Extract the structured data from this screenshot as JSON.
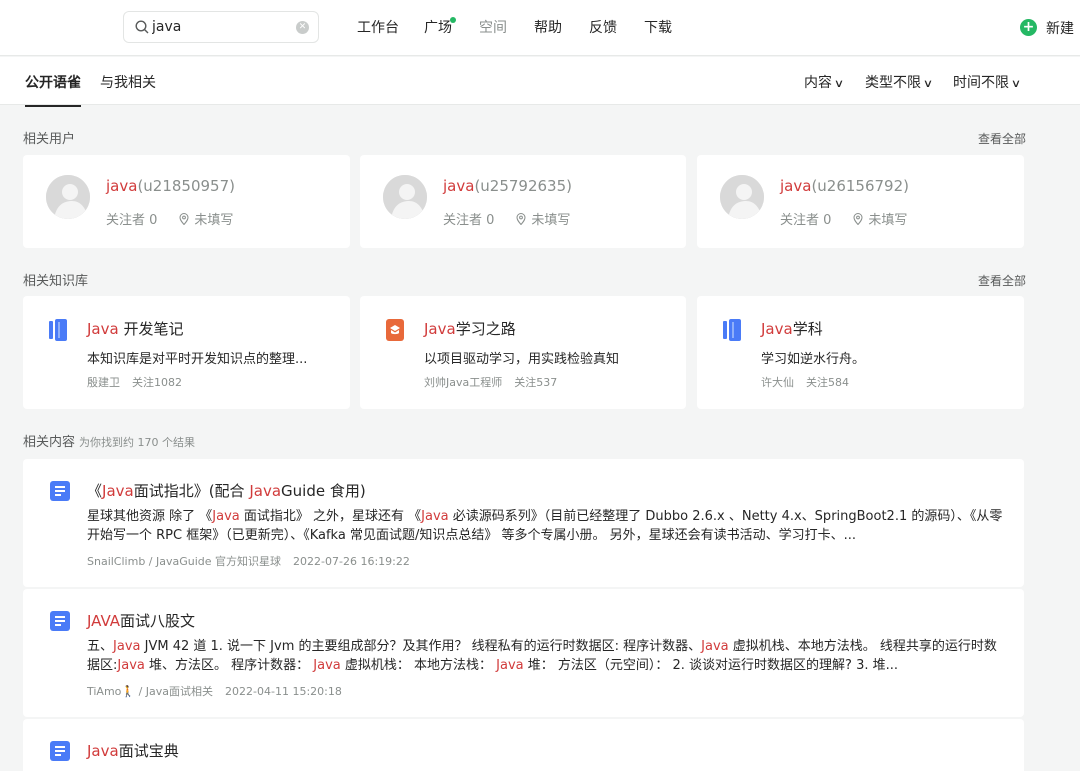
{
  "search": {
    "value": "java",
    "clear_icon": "close-circle-icon"
  },
  "nav": {
    "items": [
      "工作台",
      "广场",
      "空间",
      "帮助",
      "反馈",
      "下载"
    ],
    "new_label": "新建"
  },
  "tabs": [
    "公开语雀",
    "与我相关"
  ],
  "filters": [
    "内容",
    "类型不限",
    "时间不限"
  ],
  "users_section": {
    "title": "相关用户",
    "see_all": "查看全部",
    "users": [
      {
        "name_hl": "java",
        "name_rest": "(u21850957)",
        "followers": "关注者 0",
        "location": "未填写"
      },
      {
        "name_hl": "java",
        "name_rest": "(u25792635)",
        "followers": "关注者 0",
        "location": "未填写"
      },
      {
        "name_hl": "java",
        "name_rest": "(u26156792)",
        "followers": "关注者 0",
        "location": "未填写"
      }
    ]
  },
  "kb_section": {
    "title": "相关知识库",
    "see_all": "查看全部",
    "books": [
      {
        "name_hl": "Java",
        "name_rest": " 开发笔记",
        "desc": "本知识库是对平时开发知识点的整理...",
        "owner": "殷建卫",
        "follows": "关注1082",
        "icon": "book-blue-icon",
        "color": "#4a7bf7"
      },
      {
        "name_hl": "Java",
        "name_rest": "学习之路",
        "desc": "以项目驱动学习，用实践检验真知",
        "owner": "刘帅Java工程师",
        "follows": "关注537",
        "icon": "book-orange-icon",
        "color": "#e8693a"
      },
      {
        "name_hl": "Java",
        "name_rest": "学科",
        "desc": "学习如逆水行舟。",
        "owner": "许大仙",
        "follows": "关注584",
        "icon": "book-blue-icon",
        "color": "#4a7bf7"
      }
    ]
  },
  "docs_section": {
    "title": "相关内容",
    "count_text": "为你找到约 170 个结果",
    "docs": [
      {
        "title": [
          [
            "《",
            false
          ],
          [
            "Java",
            true
          ],
          [
            "面试指北》(配合 ",
            false
          ],
          [
            "Java",
            true
          ],
          [
            "Guide 食用)",
            false
          ]
        ],
        "desc": [
          [
            "星球其他资源 除了 《",
            false
          ],
          [
            "Java",
            true
          ],
          [
            " 面试指北》 之外，星球还有 《",
            false
          ],
          [
            "Java",
            true
          ],
          [
            " 必读源码系列》（目前已经整理了 Dubbo 2.6.x 、Netty 4.x、SpringBoot2.1 的源码）、《从零开始写一个 RPC 框架》（已更新完）、《Kafka 常见面试题/知识点总结》 等多个专属小册。 另外，星球还会有读书活动、学习打卡、...",
            false
          ]
        ],
        "source": "SnailClimb / JavaGuide 官方知识星球",
        "time": "2022-07-26 16:19:22"
      },
      {
        "title": [
          [
            "JAVA",
            true
          ],
          [
            "面试八股文",
            false
          ]
        ],
        "desc": [
          [
            "五、",
            false
          ],
          [
            "Java",
            true
          ],
          [
            " JVM 42 道 1. 说一下 Jvm 的主要组成部分？及其作用？ 线程私有的运行时数据区: 程序计数器、",
            false
          ],
          [
            "Java",
            true
          ],
          [
            " 虚拟机栈、本地方法栈。 线程共享的运行时数据区:",
            false
          ],
          [
            "Java",
            true
          ],
          [
            " 堆、方法区。 程序计数器： ",
            false
          ],
          [
            "Java",
            true
          ],
          [
            " 虚拟机栈： 本地方法栈： ",
            false
          ],
          [
            "Java",
            true
          ],
          [
            " 堆： 方法区（元空间）： 2. 谈谈对运行时数据区的理解? 3. 堆...",
            false
          ]
        ],
        "source": "TiAmo🚶 / Java面试相关",
        "time": "2022-04-11 15:20:18"
      },
      {
        "title": [
          [
            "Java",
            true
          ],
          [
            "面试宝典",
            false
          ]
        ],
        "desc": [],
        "source": "",
        "time": ""
      }
    ]
  },
  "colors": {
    "brand_green": "#25b864",
    "highlight_red": "#d13b3b",
    "doc_blue": "#4a7bf7"
  }
}
